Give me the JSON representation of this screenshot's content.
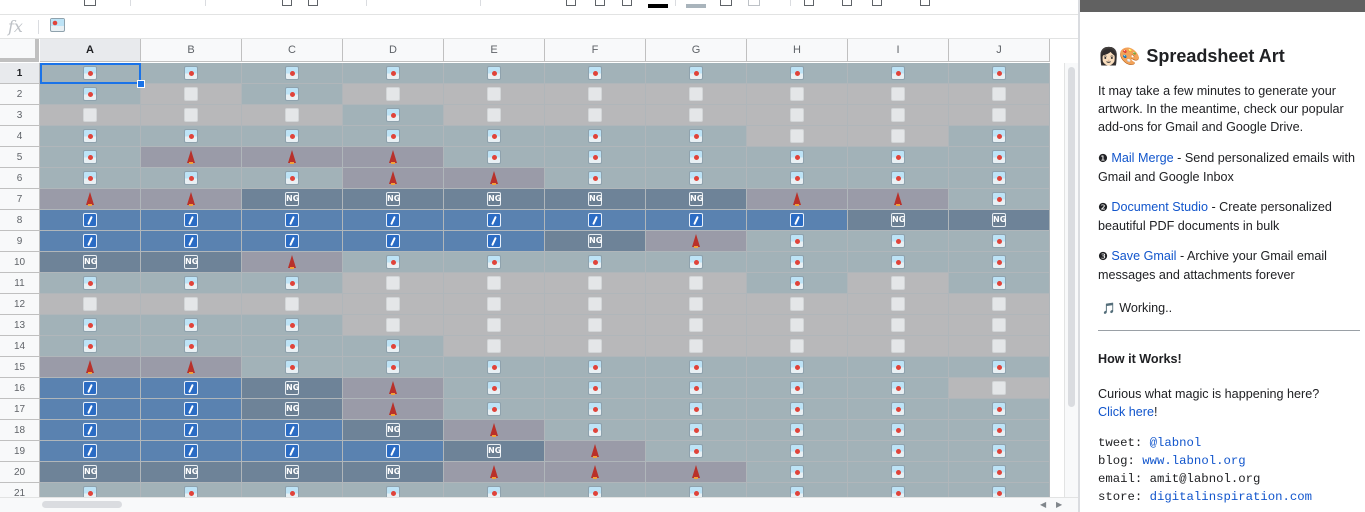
{
  "formula_bar": {
    "fx_label": "fx"
  },
  "grid": {
    "columns": [
      "A",
      "B",
      "C",
      "D",
      "E",
      "F",
      "G",
      "H",
      "I",
      "J"
    ],
    "selected_cell": "A1",
    "row_numbers": [
      1,
      2,
      3,
      4,
      5,
      6,
      7,
      8,
      9,
      10,
      11,
      12,
      13,
      14,
      15,
      16,
      17,
      18,
      19,
      20,
      21
    ],
    "cell_backgrounds": {
      "photo": "#a2b2b8",
      "blank": "#b8b8ba",
      "rocket": "#9a9ba8",
      "ng": "#6e8398",
      "slash": "#5a82b0"
    },
    "rows": [
      [
        "photo",
        "photo",
        "photo",
        "photo",
        "photo",
        "photo",
        "photo",
        "photo",
        "photo",
        "photo"
      ],
      [
        "photo",
        "blank",
        "photo",
        "blank",
        "blank",
        "blank",
        "blank",
        "blank",
        "blank",
        "blank"
      ],
      [
        "blank",
        "blank",
        "blank",
        "photo",
        "blank",
        "blank",
        "blank",
        "blank",
        "blank",
        "blank"
      ],
      [
        "photo",
        "photo",
        "photo",
        "photo",
        "photo",
        "photo",
        "photo",
        "blank",
        "blank",
        "photo"
      ],
      [
        "photo",
        "rocket",
        "rocket",
        "rocket",
        "photo",
        "photo",
        "photo",
        "photo",
        "photo",
        "photo"
      ],
      [
        "photo",
        "photo",
        "photo",
        "rocket",
        "rocket",
        "photo",
        "photo",
        "photo",
        "photo",
        "photo"
      ],
      [
        "rocket",
        "rocket",
        "ng",
        "ng",
        "ng",
        "ng",
        "ng",
        "rocket",
        "rocket",
        "photo"
      ],
      [
        "slash",
        "slash",
        "slash",
        "slash",
        "slash",
        "slash",
        "slash",
        "slash",
        "ng",
        "ng"
      ],
      [
        "slash",
        "slash",
        "slash",
        "slash",
        "slash",
        "ng",
        "rocket",
        "photo",
        "photo",
        "photo"
      ],
      [
        "ng",
        "ng",
        "rocket",
        "photo",
        "photo",
        "photo",
        "photo",
        "photo",
        "photo",
        "photo"
      ],
      [
        "photo",
        "photo",
        "photo",
        "blank",
        "blank",
        "blank",
        "blank",
        "photo",
        "blank",
        "photo"
      ],
      [
        "blank",
        "blank",
        "blank",
        "blank",
        "blank",
        "blank",
        "blank",
        "blank",
        "blank",
        "blank"
      ],
      [
        "photo",
        "photo",
        "photo",
        "blank",
        "blank",
        "blank",
        "blank",
        "blank",
        "blank",
        "blank"
      ],
      [
        "photo",
        "photo",
        "photo",
        "photo",
        "blank",
        "blank",
        "blank",
        "blank",
        "blank",
        "blank"
      ],
      [
        "rocket",
        "rocket",
        "photo",
        "photo",
        "photo",
        "photo",
        "photo",
        "photo",
        "photo",
        "photo"
      ],
      [
        "slash",
        "slash",
        "ng",
        "rocket",
        "photo",
        "photo",
        "photo",
        "photo",
        "photo",
        "blank"
      ],
      [
        "slash",
        "slash",
        "ng",
        "rocket",
        "photo",
        "photo",
        "photo",
        "photo",
        "photo",
        "photo"
      ],
      [
        "slash",
        "slash",
        "slash",
        "ng",
        "rocket",
        "photo",
        "photo",
        "photo",
        "photo",
        "photo"
      ],
      [
        "slash",
        "slash",
        "slash",
        "slash",
        "ng",
        "rocket",
        "photo",
        "photo",
        "photo",
        "photo"
      ],
      [
        "ng",
        "ng",
        "ng",
        "ng",
        "rocket",
        "rocket",
        "rocket",
        "photo",
        "photo",
        "photo"
      ],
      [
        "photo",
        "photo",
        "photo",
        "photo",
        "photo",
        "photo",
        "photo",
        "photo",
        "photo",
        "photo"
      ]
    ]
  },
  "panel": {
    "title_emoji": "👩🏻🎨",
    "title": "Spreadsheet Art",
    "intro": "It may take a few minutes to generate your artwork. In the meantime, check our popular add-ons for Gmail and Google Drive.",
    "addons": [
      {
        "bullet": "❶",
        "name": "Mail Merge",
        "desc": " - Send personalized emails with Gmail and Google Inbox"
      },
      {
        "bullet": "❷",
        "name": "Document Studio",
        "desc": " - Create personalized beautiful PDF documents in bulk"
      },
      {
        "bullet": "❸",
        "name": "Save Gmail",
        "desc": " - Archive your Gmail email messages and attachments forever"
      }
    ],
    "status_icon": "🎵",
    "status": "Working..",
    "how_heading": "How it Works!",
    "how_text": "Curious what magic is happening here?",
    "how_link": "Click here",
    "how_after": "!",
    "contacts": [
      {
        "label": "tweet: ",
        "value": "@labnol",
        "link": true
      },
      {
        "label": "blog: ",
        "value": "www.labnol.org",
        "link": true
      },
      {
        "label": "email: ",
        "value": "amit@labnol.org",
        "link": false
      },
      {
        "label": "store: ",
        "value": "digitalinspiration.com",
        "link": true
      }
    ]
  }
}
